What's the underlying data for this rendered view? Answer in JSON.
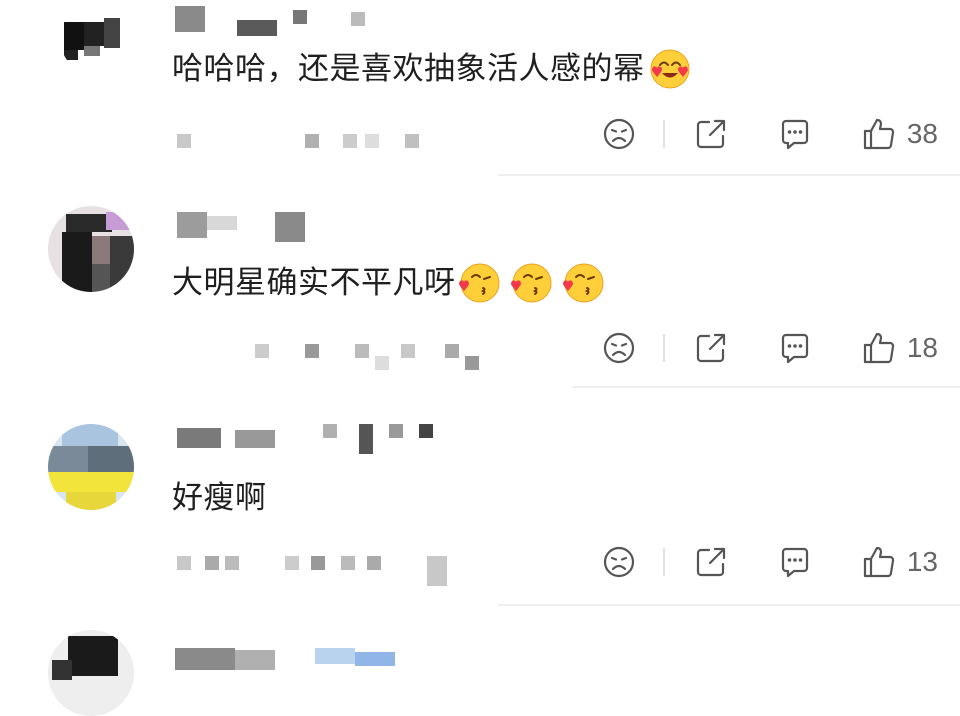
{
  "comments": [
    {
      "text": "哈哈哈，还是喜欢抽象活人感的幂",
      "likes": "38"
    },
    {
      "text": "大明星确实不平凡呀",
      "likes": "18"
    },
    {
      "text": "好瘦啊",
      "likes": "13"
    }
  ],
  "colors": {
    "text": "#1f1f1f",
    "icon": "#555555",
    "divider": "#efefef",
    "emoji": "#ffcf3a"
  },
  "icons": [
    "sad-face-icon",
    "share-icon",
    "reply-icon",
    "thumbs-up-icon",
    "face-blowing-kiss-icon",
    "smiling-face-with-hearts-icon"
  ]
}
